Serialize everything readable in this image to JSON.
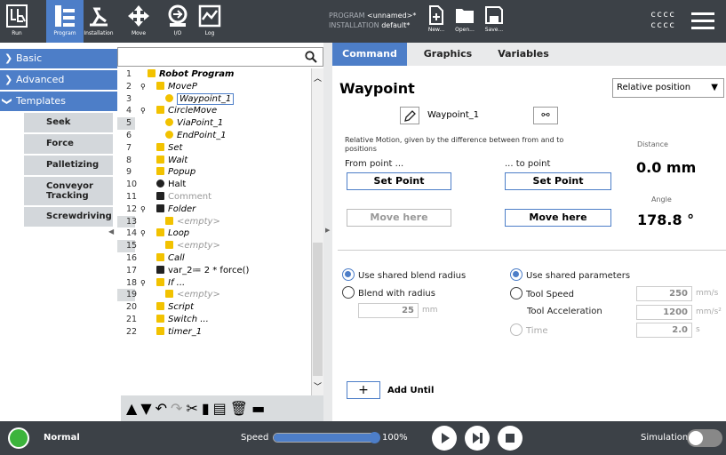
{
  "topbar": {
    "nav": [
      {
        "label": "Run",
        "icon": "ur-logo-icon"
      },
      {
        "label": "Program",
        "icon": "program-icon"
      },
      {
        "label": "Installation",
        "icon": "installation-icon"
      },
      {
        "label": "Move",
        "icon": "move-icon"
      },
      {
        "label": "I/O",
        "icon": "io-icon"
      },
      {
        "label": "Log",
        "icon": "log-icon"
      }
    ],
    "program_key": "PROGRAM",
    "program_value": "<unnamed>*",
    "installation_key": "INSTALLATION",
    "installation_value": "default*",
    "file_buttons": [
      {
        "label": "New...",
        "icon": "new-file-icon"
      },
      {
        "label": "Open...",
        "icon": "open-folder-icon"
      },
      {
        "label": "Save...",
        "icon": "save-icon"
      }
    ],
    "user_line1": "cccc",
    "user_line2": "cccc"
  },
  "sidebar": {
    "categories": [
      {
        "label": "Basic",
        "expanded": false
      },
      {
        "label": "Advanced",
        "expanded": false
      },
      {
        "label": "Templates",
        "expanded": true
      }
    ],
    "templates": [
      "Seek",
      "Force",
      "Palletizing",
      "Conveyor Tracking",
      "Screwdriving"
    ]
  },
  "tree": {
    "search_placeholder": "",
    "rows": [
      {
        "n": "1",
        "indent": 0,
        "text": "Robot Program",
        "icon": "program-flag",
        "style": "bolditalic"
      },
      {
        "n": "2",
        "indent": 1,
        "text": "MoveP",
        "icon": "move",
        "style": "italic",
        "pin": true
      },
      {
        "n": "3",
        "indent": 2,
        "text": "Waypoint_1",
        "icon": "waypoint",
        "style": "italic-selected"
      },
      {
        "n": "4",
        "indent": 1,
        "text": "CircleMove",
        "icon": "program-flag",
        "style": "italic",
        "pin": true
      },
      {
        "n": "5",
        "indent": 2,
        "text": "ViaPoint_1",
        "icon": "waypoint",
        "style": "italic"
      },
      {
        "n": "6",
        "indent": 2,
        "text": "EndPoint_1",
        "icon": "waypoint",
        "style": "italic"
      },
      {
        "n": "7",
        "indent": 1,
        "text": "Set",
        "icon": "yellow-bar",
        "style": "italic"
      },
      {
        "n": "8",
        "indent": 1,
        "text": "Wait",
        "icon": "hourglass",
        "style": "italic"
      },
      {
        "n": "9",
        "indent": 1,
        "text": "Popup",
        "icon": "popup",
        "style": "italic"
      },
      {
        "n": "10",
        "indent": 1,
        "text": "Halt",
        "icon": "halt",
        "style": "normal"
      },
      {
        "n": "11",
        "indent": 1,
        "text": "Comment",
        "icon": "comment",
        "style": "gray"
      },
      {
        "n": "12",
        "indent": 1,
        "text": "Folder",
        "icon": "folder",
        "style": "italic",
        "pin": true
      },
      {
        "n": "13",
        "indent": 2,
        "text": "<empty>",
        "icon": "yellow-bar",
        "style": "gray-italic"
      },
      {
        "n": "14",
        "indent": 1,
        "text": "Loop",
        "icon": "loop",
        "style": "italic",
        "pin": true
      },
      {
        "n": "15",
        "indent": 2,
        "text": "<empty>",
        "icon": "yellow-bar",
        "style": "gray-italic"
      },
      {
        "n": "16",
        "indent": 1,
        "text": "Call",
        "icon": "call",
        "style": "italic"
      },
      {
        "n": "17",
        "indent": 1,
        "text": "var_2≔ 2 * force()",
        "icon": "assign",
        "style": "normal"
      },
      {
        "n": "18",
        "indent": 1,
        "text": "If ...",
        "icon": "if",
        "style": "italic",
        "pin": true
      },
      {
        "n": "19",
        "indent": 2,
        "text": "<empty>",
        "icon": "yellow-bar",
        "style": "gray-italic"
      },
      {
        "n": "20",
        "indent": 1,
        "text": "Script",
        "icon": "script",
        "style": "italic"
      },
      {
        "n": "21",
        "indent": 1,
        "text": "Switch ...",
        "icon": "switch",
        "style": "italic"
      },
      {
        "n": "22",
        "indent": 1,
        "text": "timer_1",
        "icon": "timer",
        "style": "italic"
      }
    ],
    "tools": [
      "move-up-icon",
      "move-down-icon",
      "undo-icon",
      "redo-icon",
      "cut-icon",
      "copy-icon",
      "paste-icon",
      "delete-icon",
      "suppress-icon"
    ]
  },
  "tabs": [
    "Command",
    "Graphics",
    "Variables"
  ],
  "waypoint": {
    "title": "Waypoint",
    "mode": "Relative position",
    "name": "Waypoint_1",
    "description": "Relative Motion, given by the difference between from and to positions",
    "from_label": "From point ...",
    "to_label": "... to point",
    "set_point": "Set Point",
    "move_here": "Move here",
    "distance_label": "Distance",
    "distance_value": "0.0 mm",
    "angle_label": "Angle",
    "angle_value": "178.8 °",
    "blend_shared": "Use shared blend radius",
    "blend_with_radius": "Blend with radius",
    "blend_value": "25",
    "blend_unit": "mm",
    "params_shared": "Use shared parameters",
    "tool_speed": "Tool Speed",
    "tool_speed_value": "250",
    "tool_speed_unit": "mm/s",
    "tool_accel": "Tool Acceleration",
    "tool_accel_value": "1200",
    "tool_accel_unit": "mm/s²",
    "time": "Time",
    "time_value": "2.0",
    "time_unit": "s",
    "add_until": "Add Until"
  },
  "footer": {
    "status": "Normal",
    "speed_label": "Speed",
    "speed_value": "100%",
    "speed_fraction": 1.0,
    "simulation": "Simulation"
  }
}
